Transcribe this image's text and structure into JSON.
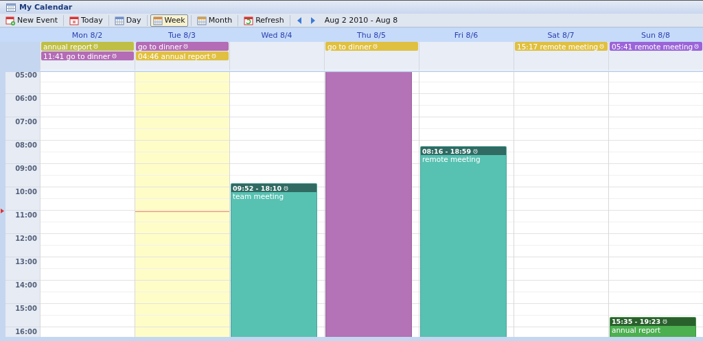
{
  "window": {
    "title": "My Calendar"
  },
  "toolbar": {
    "buttons": [
      {
        "label": "New Event",
        "kind": "new",
        "selected": false
      },
      {
        "label": "Today",
        "kind": "today",
        "selected": false
      },
      {
        "label": "Day",
        "kind": "day",
        "selected": false
      },
      {
        "label": "Week",
        "kind": "week",
        "selected": true
      },
      {
        "label": "Month",
        "kind": "month",
        "selected": false
      },
      {
        "label": "Refresh",
        "kind": "refresh",
        "selected": false
      }
    ],
    "range": "Aug 2 2010 - Aug 8"
  },
  "hours": [
    "05:00",
    "06:00",
    "07:00",
    "08:00",
    "09:00",
    "10:00",
    "11:00",
    "12:00",
    "13:00",
    "14:00",
    "15:00",
    "16:00"
  ],
  "days": [
    {
      "label": "Mon 8/2",
      "selected": false,
      "all_day": [
        {
          "text": "annual report",
          "color": "#bfbf45"
        },
        {
          "text": "11:41 go to dinner",
          "color": "#b36cb5"
        }
      ]
    },
    {
      "label": "Tue 8/3",
      "selected": true,
      "all_day": [
        {
          "text": "go to dinner",
          "color": "#b36cb5"
        },
        {
          "text": "04:46 annual report",
          "color": "#e0c040"
        }
      ]
    },
    {
      "label": "Wed 8/4",
      "selected": false,
      "events": [
        {
          "kind": "timed",
          "time": "09:52 - 18:10",
          "title": "team meeting",
          "color": "#57c1b2"
        }
      ]
    },
    {
      "label": "Thu 8/5",
      "selected": false,
      "all_day": [
        {
          "text": "go to dinner",
          "color": "#e0c040"
        }
      ],
      "events": [
        {
          "kind": "block",
          "color": "#b373b6"
        }
      ]
    },
    {
      "label": "Fri 8/6",
      "selected": false,
      "events": [
        {
          "kind": "timed",
          "time": "08:16 - 18:59",
          "title": "remote meeting",
          "color": "#57c1b2"
        }
      ]
    },
    {
      "label": "Sat 8/7",
      "selected": false,
      "all_day": [
        {
          "text": "15:17 remote meeting",
          "color": "#e0c040"
        }
      ]
    },
    {
      "label": "Sun 8/8",
      "selected": false,
      "all_day": [
        {
          "text": "05:41 remote meeting",
          "color": "#9b64d8"
        }
      ],
      "events": [
        {
          "kind": "timed",
          "time": "15:35 - 19:23",
          "title": "annual report",
          "color": "#4caf50"
        }
      ]
    }
  ]
}
